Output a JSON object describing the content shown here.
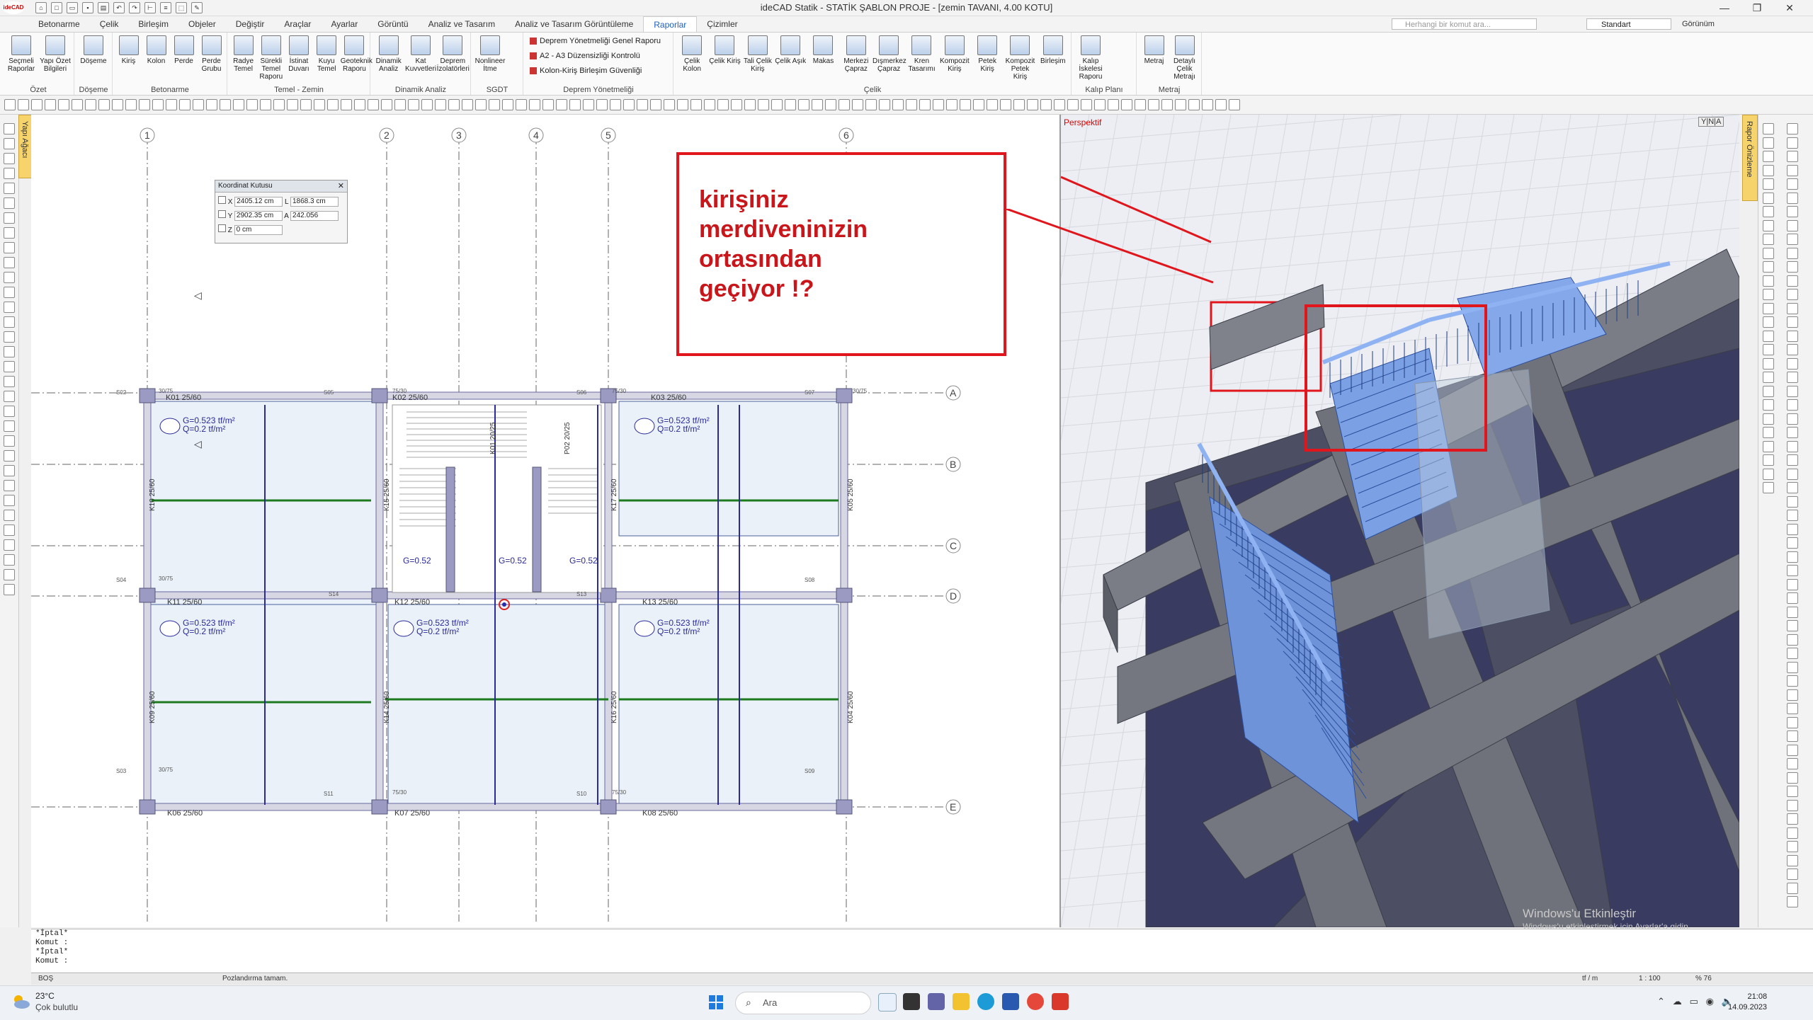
{
  "window": {
    "title": "ideCAD Statik - STATİK ŞABLON PROJE - [zemin TAVANI,  4.00 KOTU]",
    "logo": "ideCAD"
  },
  "menu": {
    "tabs": [
      "Betonarme",
      "Çelik",
      "Birleşim",
      "Objeler",
      "Değiştir",
      "Araçlar",
      "Ayarlar",
      "Görüntü",
      "Analiz ve Tasarım",
      "Analiz ve Tasarım Görüntüleme",
      "Raporlar",
      "Çizimler"
    ],
    "active_tab": "Raporlar",
    "search_placeholder": "Herhangi bir komut ara...",
    "standard_select": "Standart",
    "view_label": "Görünüm"
  },
  "ribbon": {
    "groups": [
      {
        "label": "Özet",
        "buttons": [
          "Seçmeli Raporlar",
          "Yapı Özet Bilgileri"
        ]
      },
      {
        "label": "Döşeme",
        "buttons": [
          "Döşeme"
        ]
      },
      {
        "label": "Betonarme",
        "buttons": [
          "Kiriş",
          "Kolon",
          "Perde",
          "Perde Grubu"
        ]
      },
      {
        "label": "Temel - Zemin",
        "buttons": [
          "Radye Temel",
          "Sürekli Temel Raporu",
          "İstinat Duvarı",
          "Kuyu Temel",
          "Geoteknik Raporu"
        ]
      },
      {
        "label": "Dinamik Analiz",
        "buttons": [
          "Dinamik Analiz",
          "Kat Kuvvetleri",
          "Deprem İzolatörleri"
        ]
      },
      {
        "label": "SGDT",
        "buttons": [
          "Nonlineer İtme"
        ]
      },
      {
        "label": "Deprem Yönetmeliği",
        "buttons": [
          "Deprem Yönetmeliği Genel Raporu",
          "A2 - A3 Düzensizliği Kontrolü",
          "Kolon-Kiriş Birleşim Güvenliği"
        ]
      },
      {
        "label": "Çelik",
        "buttons": [
          "Çelik Kolon",
          "Çelik Kiriş",
          "Tali Çelik Kiriş",
          "Çelik Aşık",
          "Makas",
          "Merkezi Çapraz",
          "Dışmerkez Çapraz",
          "Kren Tasarımı",
          "Kompozit Kiriş",
          "Petek Kiriş",
          "Kompozit Petek Kiriş",
          "Birleşim"
        ]
      },
      {
        "label": "Kalıp Planı",
        "buttons": [
          "Kalıp İskelesi Raporu"
        ]
      },
      {
        "label": "Metraj",
        "buttons": [
          "Metraj",
          "Detaylı Çelik Metrajı"
        ]
      }
    ]
  },
  "side_tabs": {
    "left": "Yapı Ağacı",
    "right": "Rapor Önizleme"
  },
  "coord_box": {
    "title": "Koordinat Kutusu",
    "x": "2405.12 cm",
    "l": "1868.3 cm",
    "y": "2902.35 cm",
    "a": "242.056",
    "z": "0 cm",
    "x_label": "X",
    "y_label": "Y",
    "z_label": "Z",
    "l_label": "L",
    "a_label": "A"
  },
  "plan": {
    "axes_x": [
      "1",
      "2",
      "3",
      "4",
      "5",
      "6"
    ],
    "axes_y": [
      "A",
      "B",
      "C",
      "D",
      "E"
    ],
    "beams": [
      "K01 25/60",
      "K02 25/60",
      "K03 25/60",
      "K11 25/60",
      "K12 25/60",
      "K13 25/60",
      "K06 25/60",
      "K07 25/60",
      "K08 25/60",
      "K10 25/60",
      "K15 25/60",
      "K14 25/60",
      "K09 25/60",
      "K05 25/60",
      "K04 25/60",
      "K16 25/60",
      "K17 25/60",
      "K01 20/25",
      "P02 20/25"
    ],
    "columns": [
      "S02",
      "S05",
      "S06",
      "S07",
      "S04",
      "S14",
      "S13",
      "S08",
      "S03",
      "S11",
      "S10",
      "S09"
    ],
    "load_g": "G=0.523 tf/m²",
    "load_q": "Q=0.2 tf/m²",
    "load_g_short": "G=0.52",
    "dim_label": "30/75",
    "dim_label2": "75/30",
    "dim_label3": "60/30"
  },
  "perspective": {
    "label": "Perspektif",
    "yna": "Y|N|A"
  },
  "callout": {
    "text": "kirişiniz\nmerdiveninizin\nortasından\ngeçiyor !?"
  },
  "command": {
    "lines": [
      "*İptal*",
      "Komut :",
      "*İptal*",
      "Komut :"
    ]
  },
  "status": {
    "left": "BOŞ",
    "msg": "Pozlandırma tamam.",
    "unit": "tf / m",
    "scale": "1 : 100",
    "zoom": "% 76"
  },
  "taskbar": {
    "temp": "23°C",
    "cond": "Çok bulutlu",
    "search": "Ara",
    "time": "21:08",
    "date": "14.09.2023"
  },
  "watermark": {
    "line1": "Windows'u Etkinleştir",
    "line2": "Windows'u etkinleştirmek için Ayarlar'a gidin."
  }
}
